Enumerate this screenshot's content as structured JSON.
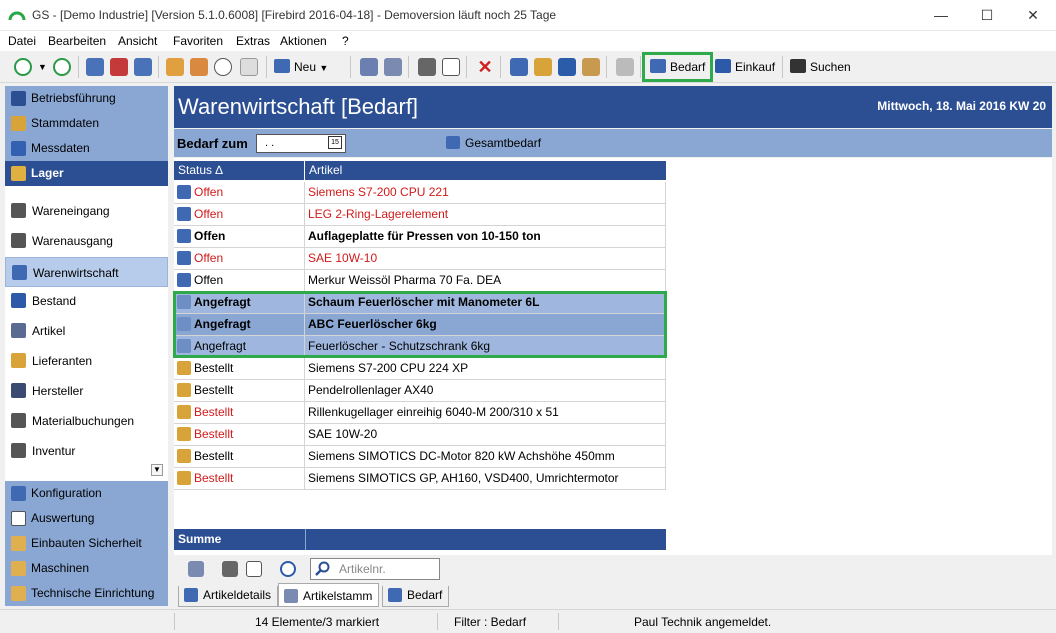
{
  "window": {
    "title": "GS - [Demo Industrie]  [Version  5.1.0.6008]  [Firebird 2016-04-18]  - Demoversion läuft noch 25 Tage",
    "minimize": "—",
    "maximize": "☐",
    "close": "✕"
  },
  "menu": [
    "Datei",
    "Bearbeiten",
    "Ansicht",
    "Favoriten",
    "Extras",
    "Aktionen",
    "?"
  ],
  "toolbar": {
    "neu_label": "Neu",
    "bedarf_label": "Bedarf",
    "einkauf_label": "Einkauf",
    "suchen_label": "Suchen",
    "accent_color": "#2c4f94",
    "highlight_color": "#2eaa4a"
  },
  "sidebar": {
    "top_items": [
      {
        "label": "Betriebsführung",
        "icon": "company-icon"
      },
      {
        "label": "Stammdaten",
        "icon": "masterdata-icon"
      },
      {
        "label": "Messdaten",
        "icon": "measure-icon"
      }
    ],
    "active_group": "Lager",
    "sub_items": [
      {
        "label": "Wareneingang",
        "icon": "goods-in-icon"
      },
      {
        "label": "Warenausgang",
        "icon": "goods-out-icon"
      },
      {
        "label": "Warenwirtschaft",
        "icon": "inventory-mgmt-icon"
      },
      {
        "label": "Bestand",
        "icon": "stock-icon"
      },
      {
        "label": "Artikel",
        "icon": "article-icon"
      },
      {
        "label": "Lieferanten",
        "icon": "supplier-icon"
      },
      {
        "label": "Hersteller",
        "icon": "manufacturer-icon"
      },
      {
        "label": "Materialbuchungen",
        "icon": "booking-icon"
      },
      {
        "label": "Inventur",
        "icon": "inventory-count-icon"
      }
    ],
    "bottom_items": [
      {
        "label": "Konfiguration",
        "icon": "config-icon"
      },
      {
        "label": "Auswertung",
        "icon": "report-icon"
      },
      {
        "label": "Einbauten Sicherheit",
        "icon": "folder-icon"
      },
      {
        "label": "Maschinen",
        "icon": "folder-icon"
      },
      {
        "label": "Technische Einrichtung",
        "icon": "folder-icon"
      }
    ]
  },
  "main": {
    "title": "Warenwirtschaft [Bedarf]",
    "date": "Mittwoch, 18. Mai 2016  KW 20",
    "filter_label": "Bedarf zum",
    "filter_value": ". .",
    "filter_cal": "15",
    "gesamt_label": "Gesamtbedarf",
    "columns": [
      "Status",
      "Artikel"
    ],
    "sort_indicator": "∆",
    "rows": [
      {
        "status": "Offen",
        "artikel": "Siemens S7-200 CPU 221",
        "kind": "offen",
        "style": "red"
      },
      {
        "status": "Offen",
        "artikel": "LEG 2-Ring-Lagerelement",
        "kind": "offen",
        "style": "red"
      },
      {
        "status": "Offen",
        "artikel": "Auflageplatte für Pressen von 10-150 ton",
        "kind": "offen",
        "style": "bold"
      },
      {
        "status": "Offen",
        "artikel": "SAE 10W-10",
        "kind": "offen",
        "style": "red"
      },
      {
        "status": "Offen",
        "artikel": "Merkur Weissöl Pharma 70 Fa. DEA",
        "kind": "offen",
        "style": "normal"
      },
      {
        "status": "Angefragt",
        "artikel": "Schaum Feuerlöscher mit Manometer 6L",
        "kind": "anfr",
        "style": "bold",
        "selected": 1
      },
      {
        "status": "Angefragt",
        "artikel": "ABC Feuerlöscher  6kg",
        "kind": "anfr",
        "style": "bold",
        "selected": 2
      },
      {
        "status": "Angefragt",
        "artikel": "Feuerlöscher - Schutzschrank 6kg",
        "kind": "anfr",
        "style": "normal",
        "selected": 1
      },
      {
        "status": "Bestellt",
        "artikel": "Siemens S7-200 CPU 224 XP",
        "kind": "best",
        "style": "normal"
      },
      {
        "status": "Bestellt",
        "artikel": "Pendelrollenlager AX40",
        "kind": "best",
        "style": "normal"
      },
      {
        "status": "Bestellt",
        "artikel": "Rillenkugellager einreihig 6040-M 200/310 x 51",
        "kind": "best",
        "style": "redstatus"
      },
      {
        "status": "Bestellt",
        "artikel": "SAE 10W-20",
        "kind": "best",
        "style": "redstatus"
      },
      {
        "status": "Bestellt",
        "artikel": "Siemens SIMOTICS DC-Motor 820 kW  Achshöhe 450mm",
        "kind": "best",
        "style": "normal"
      },
      {
        "status": "Bestellt",
        "artikel": "Siemens SIMOTICS GP, AH160, VSD400, Umrichtermotor",
        "kind": "best",
        "style": "redstatus"
      }
    ],
    "summe_label": "Summe",
    "search_placeholder": "Artikelnr.",
    "tabs": [
      {
        "label": "Artikeldetails",
        "icon": "details-icon"
      },
      {
        "label": "Artikelstamm",
        "icon": "tools-icon",
        "active": true
      },
      {
        "label": "Bedarf",
        "icon": "demand-icon"
      }
    ]
  },
  "status": {
    "count": "14 Elemente/3 markiert",
    "filter": "Filter : Bedarf",
    "user": "Paul Technik angemeldet."
  }
}
